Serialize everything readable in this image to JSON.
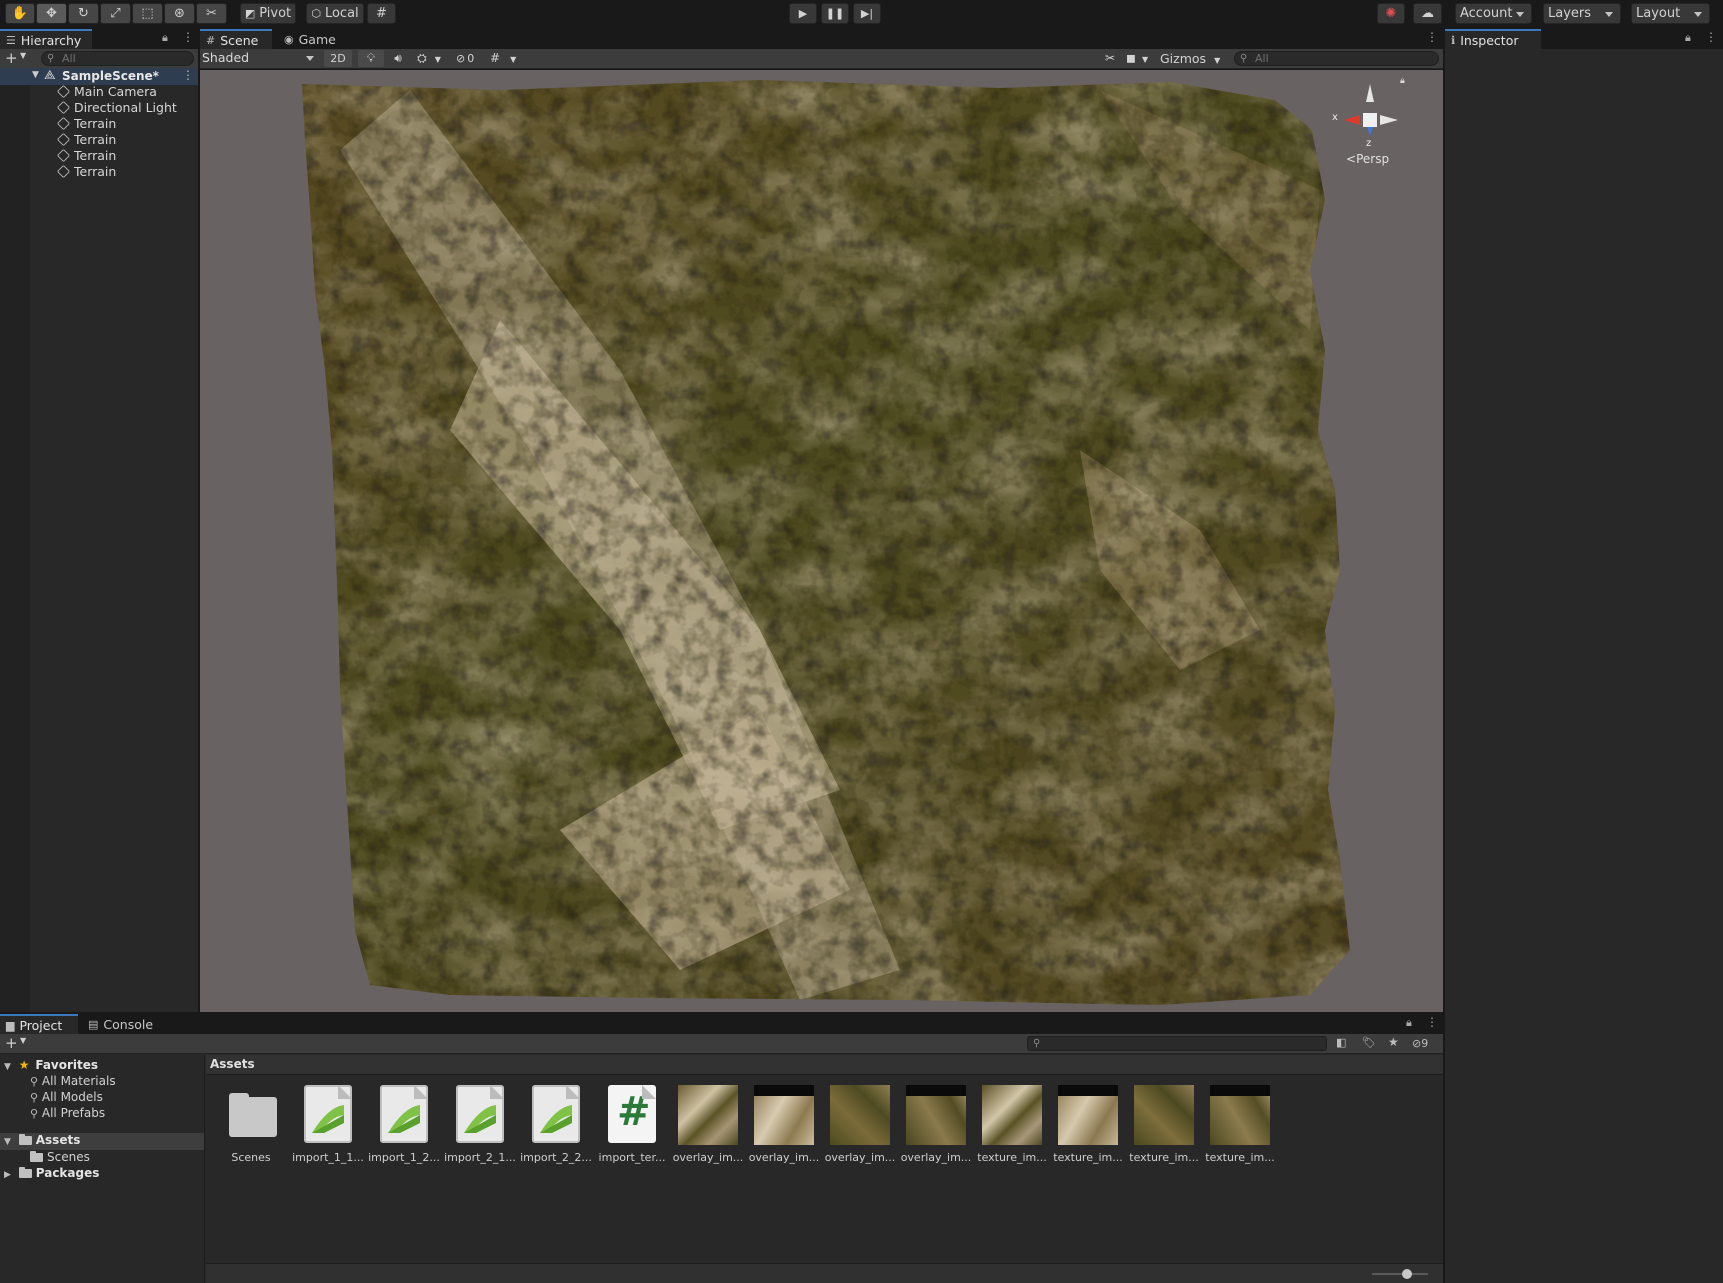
{
  "toolbar": {
    "tools": [
      "hand-tool",
      "move-tool",
      "rotate-tool",
      "scale-tool",
      "rect-tool",
      "transform-tool",
      "custom-tool"
    ],
    "pivot_label": "Pivot",
    "local_label": "Local",
    "account_label": "Account",
    "layers_label": "Layers",
    "layout_label": "Layout"
  },
  "hierarchy": {
    "tab_label": "Hierarchy",
    "search_placeholder": "All",
    "scene_name": "SampleScene*",
    "items": [
      {
        "label": "Main Camera"
      },
      {
        "label": "Directional Light"
      },
      {
        "label": "Terrain"
      },
      {
        "label": "Terrain"
      },
      {
        "label": "Terrain"
      },
      {
        "label": "Terrain"
      }
    ]
  },
  "scene": {
    "tab_scene": "Scene",
    "tab_game": "Game",
    "shading_mode": "Shaded",
    "mode_2d": "2D",
    "hidden_count": "0",
    "gizmos_label": "Gizmos",
    "search_placeholder": "All",
    "gizmo_x": "x",
    "gizmo_z": "z",
    "persp_label": "Persp"
  },
  "inspector": {
    "tab_label": "Inspector"
  },
  "project": {
    "tab_project": "Project",
    "tab_console": "Console",
    "favorites_label": "Favorites",
    "favorites": [
      "All Materials",
      "All Models",
      "All Prefabs"
    ],
    "assets_root": "Assets",
    "asset_folders": [
      "Scenes"
    ],
    "packages_label": "Packages",
    "breadcrumb": "Assets",
    "hidden_count": "9",
    "assets": [
      {
        "label": "Scenes",
        "kind": "folder"
      },
      {
        "label": "import_1_1...",
        "kind": "terrain"
      },
      {
        "label": "import_1_2...",
        "kind": "terrain"
      },
      {
        "label": "import_2_1...",
        "kind": "terrain"
      },
      {
        "label": "import_2_2...",
        "kind": "terrain"
      },
      {
        "label": "import_ter...",
        "kind": "script"
      },
      {
        "label": "overlay_im...",
        "kind": "texture"
      },
      {
        "label": "overlay_im...",
        "kind": "texture"
      },
      {
        "label": "overlay_im...",
        "kind": "texture"
      },
      {
        "label": "overlay_im...",
        "kind": "texture"
      },
      {
        "label": "texture_im...",
        "kind": "texture"
      },
      {
        "label": "texture_im...",
        "kind": "texture"
      },
      {
        "label": "texture_im...",
        "kind": "texture"
      },
      {
        "label": "texture_im...",
        "kind": "texture"
      }
    ]
  },
  "colors": {
    "accent": "#3a79bb",
    "terrain_green": "#4d4a1f",
    "terrain_rock": "#c9bb9c",
    "viewport_bg": "#696262"
  }
}
